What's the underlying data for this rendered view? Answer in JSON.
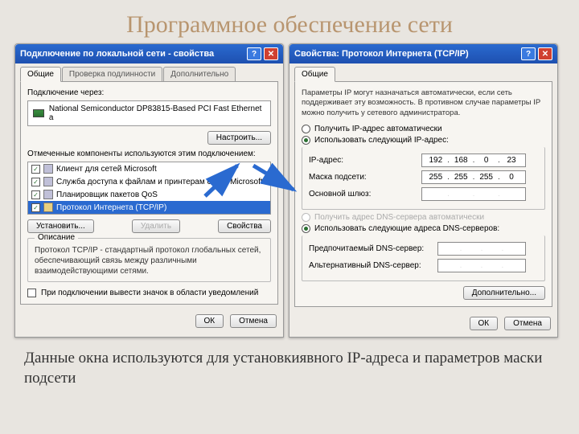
{
  "slideTitle": "Программное обеспечение сети",
  "caption": "Данные окна используются для установкиявного IP-адреса и параметров маски подсети",
  "leftWin": {
    "title": "Подключение по локальной сети - свойства",
    "tabs": [
      "Общие",
      "Проверка подлинности",
      "Дополнительно"
    ],
    "connectThroughLabel": "Подключение через:",
    "adapter": "National Semiconductor DP83815-Based PCI Fast Ethernet a",
    "configureBtn": "Настроить...",
    "componentsLabel": "Отмеченные компоненты используются этим подключением:",
    "items": [
      {
        "checked": true,
        "label": "Клиент для сетей Microsoft",
        "iconClass": ""
      },
      {
        "checked": true,
        "label": "Служба доступа к файлам и принтерам сетей Microsoft",
        "iconClass": ""
      },
      {
        "checked": true,
        "label": "Планировщик пакетов QoS",
        "iconClass": ""
      },
      {
        "checked": true,
        "label": "Протокол Интернета (TCP/IP)",
        "iconClass": "proto",
        "selected": true
      }
    ],
    "installBtn": "Установить...",
    "removeBtn": "Удалить",
    "propertiesBtn": "Свойства",
    "descGroup": "Описание",
    "descText": "Протокол TCP/IP - стандартный протокол глобальных сетей, обеспечивающий связь между различными взаимодействующими сетями.",
    "trayCheck": "При подключении вывести значок в области уведомлений",
    "ok": "ОК",
    "cancel": "Отмена"
  },
  "rightWin": {
    "title": "Свойства: Протокол Интернета (TCP/IP)",
    "tab": "Общие",
    "explain": "Параметры IP могут назначаться автоматически, если сеть поддерживает эту возможность. В противном случае параметры IP можно получить у сетевого администратора.",
    "radioAuto": "Получить IP-адрес автоматически",
    "radioManual": "Использовать следующий IP-адрес:",
    "ipLabel": "IP-адрес:",
    "ip": [
      "192",
      "168",
      "0",
      "23"
    ],
    "maskLabel": "Маска подсети:",
    "mask": [
      "255",
      "255",
      "255",
      "0"
    ],
    "gatewayLabel": "Основной шлюз:",
    "dnsAuto": "Получить адрес DNS-сервера автоматически",
    "dnsManual": "Использовать следующие адреса DNS-серверов:",
    "dnsPrefLabel": "Предпочитаемый DNS-сервер:",
    "dnsAltLabel": "Альтернативный DNS-сервер:",
    "advanced": "Дополнительно...",
    "ok": "ОК",
    "cancel": "Отмена"
  }
}
